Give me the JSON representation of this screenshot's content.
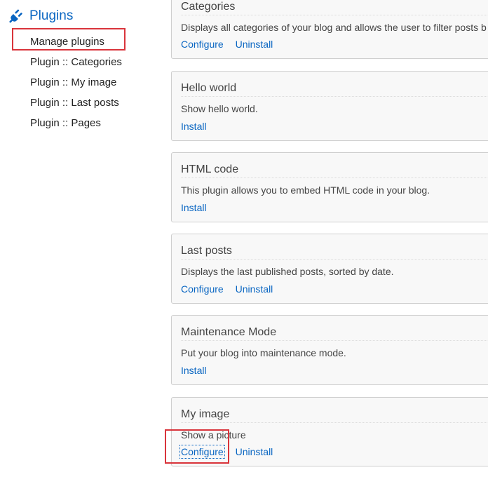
{
  "sidebar": {
    "title": "Plugins",
    "icon": "plug-icon",
    "accent_color": "#0a66c2",
    "items": [
      {
        "label": "Manage plugins",
        "highlighted": true
      },
      {
        "label": "Plugin :: Categories"
      },
      {
        "label": "Plugin :: My image"
      },
      {
        "label": "Plugin :: Last posts"
      },
      {
        "label": "Plugin :: Pages"
      }
    ]
  },
  "plugins": [
    {
      "title": "Categories",
      "description": "Displays all categories of your blog and allows the user to filter posts b",
      "actions": [
        "Configure",
        "Uninstall"
      ]
    },
    {
      "title": "Hello world",
      "description": "Show hello world.",
      "actions": [
        "Install"
      ]
    },
    {
      "title": "HTML code",
      "description": "This plugin allows you to embed HTML code in your blog.",
      "actions": [
        "Install"
      ]
    },
    {
      "title": "Last posts",
      "description": "Displays the last published posts, sorted by date.",
      "actions": [
        "Configure",
        "Uninstall"
      ]
    },
    {
      "title": "Maintenance Mode",
      "description": "Put your blog into maintenance mode.",
      "actions": [
        "Install"
      ]
    },
    {
      "title": "My image",
      "description": "Show a picture",
      "actions": [
        "Configure",
        "Uninstall"
      ],
      "focused_action": "Configure"
    }
  ],
  "highlight_color": "#d9343b"
}
